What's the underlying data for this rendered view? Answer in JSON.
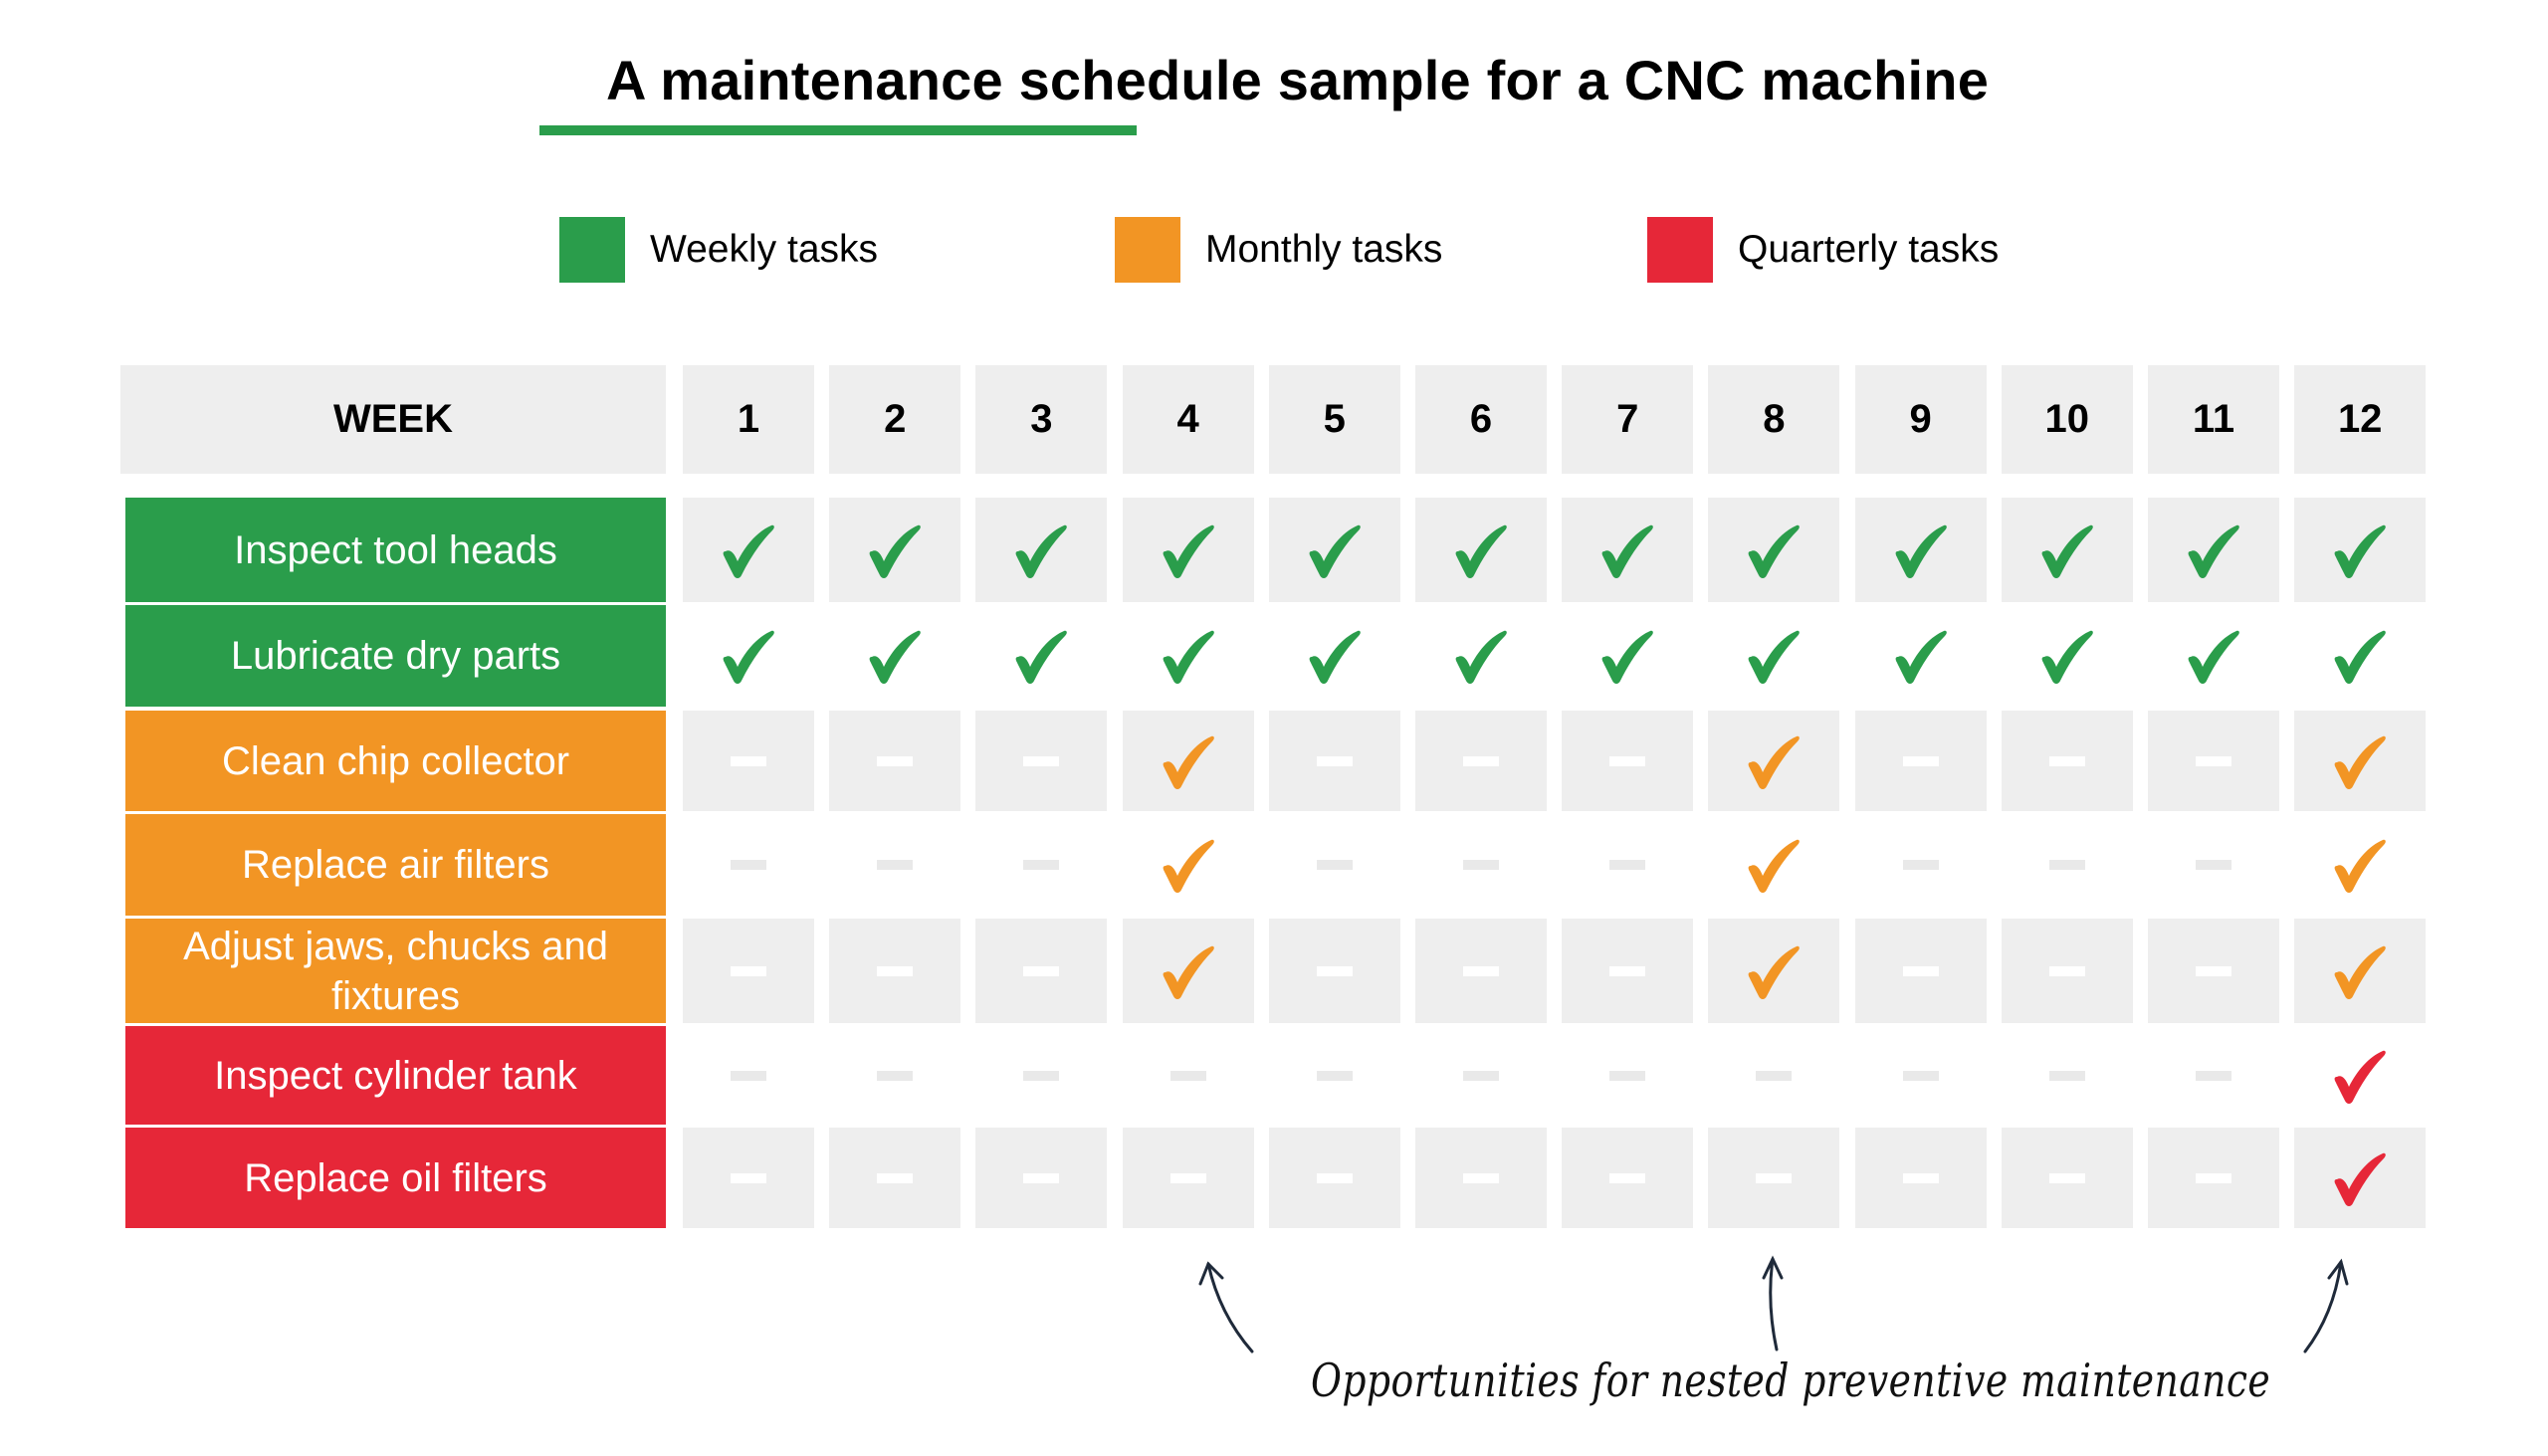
{
  "title": "A maintenance schedule sample for a CNC machine",
  "colors": {
    "weekly": "#2a9d4b",
    "monthly": "#f29524",
    "quarterly": "#e62738",
    "cell_shaded": "#eeeeee",
    "annotation": "#1f2a3a"
  },
  "legend": [
    {
      "label": "Weekly tasks",
      "color": "#2a9d4b",
      "frequency": "weekly"
    },
    {
      "label": "Monthly tasks",
      "color": "#f29524",
      "frequency": "monthly"
    },
    {
      "label": "Quarterly tasks",
      "color": "#e62738",
      "frequency": "quarterly"
    }
  ],
  "table": {
    "header_label": "WEEK",
    "weeks": [
      "1",
      "2",
      "3",
      "4",
      "5",
      "6",
      "7",
      "8",
      "9",
      "10",
      "11",
      "12"
    ],
    "rows": [
      {
        "task": "Inspect tool heads",
        "frequency": "weekly",
        "marks": [
          "check",
          "check",
          "check",
          "check",
          "check",
          "check",
          "check",
          "check",
          "check",
          "check",
          "check",
          "check"
        ]
      },
      {
        "task": "Lubricate dry parts",
        "frequency": "weekly",
        "marks": [
          "check",
          "check",
          "check",
          "check",
          "check",
          "check",
          "check",
          "check",
          "check",
          "check",
          "check",
          "check"
        ]
      },
      {
        "task": "Clean chip collector",
        "frequency": "monthly",
        "marks": [
          "dash",
          "dash",
          "dash",
          "check",
          "dash",
          "dash",
          "dash",
          "check",
          "dash",
          "dash",
          "dash",
          "check"
        ]
      },
      {
        "task": "Replace air filters",
        "frequency": "monthly",
        "marks": [
          "dash",
          "dash",
          "dash",
          "check",
          "dash",
          "dash",
          "dash",
          "check",
          "dash",
          "dash",
          "dash",
          "check"
        ]
      },
      {
        "task": "Adjust jaws, chucks and fixtures",
        "frequency": "monthly",
        "marks": [
          "dash",
          "dash",
          "dash",
          "check",
          "dash",
          "dash",
          "dash",
          "check",
          "dash",
          "dash",
          "dash",
          "check"
        ]
      },
      {
        "task": "Inspect cylinder tank",
        "frequency": "quarterly",
        "marks": [
          "dash",
          "dash",
          "dash",
          "dash",
          "dash",
          "dash",
          "dash",
          "dash",
          "dash",
          "dash",
          "dash",
          "check"
        ]
      },
      {
        "task": "Replace oil filters",
        "frequency": "quarterly",
        "marks": [
          "dash",
          "dash",
          "dash",
          "dash",
          "dash",
          "dash",
          "dash",
          "dash",
          "dash",
          "dash",
          "dash",
          "check"
        ]
      }
    ]
  },
  "annotation": {
    "caption": "Opportunities for nested preventive maintenance",
    "points_to_weeks": [
      "4",
      "8",
      "12"
    ]
  }
}
